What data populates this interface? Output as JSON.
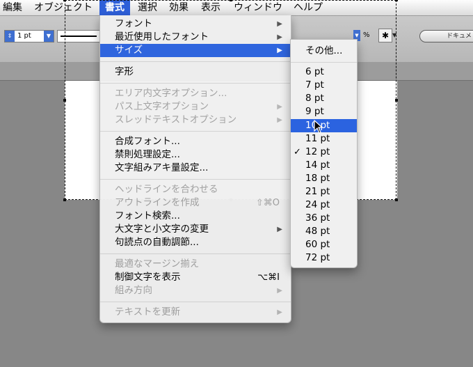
{
  "menubar": {
    "items": [
      {
        "label": "編集"
      },
      {
        "label": "オブジェクト"
      },
      {
        "label": "書式"
      },
      {
        "label": "選択"
      },
      {
        "label": "効果"
      },
      {
        "label": "表示"
      },
      {
        "label": "ウィンドウ"
      },
      {
        "label": "ヘルプ"
      }
    ]
  },
  "toolbar": {
    "stroke_value": "1 pt",
    "percent_symbol": "%",
    "doc_button": "ドキュメ"
  },
  "format_menu": {
    "items": [
      {
        "label": "フォント",
        "submenu": true
      },
      {
        "label": "最近使用したフォント",
        "submenu": true
      },
      {
        "label": "サイズ",
        "submenu": true,
        "selected": true
      },
      {
        "label": "字形"
      },
      {
        "label": "エリア内文字オプション...",
        "disabled": true
      },
      {
        "label": "パス上文字オプション",
        "disabled": true,
        "submenu": true
      },
      {
        "label": "スレッドテキストオプション",
        "disabled": true,
        "submenu": true
      },
      {
        "label": "合成フォント..."
      },
      {
        "label": "禁則処理設定..."
      },
      {
        "label": "文字組みアキ量設定..."
      },
      {
        "label": "ヘッドラインを合わせる",
        "disabled": true
      },
      {
        "label": "アウトラインを作成",
        "disabled": true,
        "shortcut": "⇧⌘O"
      },
      {
        "label": "フォント検索..."
      },
      {
        "label": "大文字と小文字の変更",
        "submenu": true
      },
      {
        "label": "句読点の自動調節..."
      },
      {
        "label": "最適なマージン揃え",
        "disabled": true
      },
      {
        "label": "制御文字を表示",
        "shortcut": "⌥⌘I"
      },
      {
        "label": "組み方向",
        "disabled": true,
        "submenu": true
      },
      {
        "label": "テキストを更新",
        "disabled": true,
        "submenu": true
      }
    ]
  },
  "size_submenu": {
    "items": [
      {
        "label": "その他..."
      },
      {
        "label": "6 pt"
      },
      {
        "label": "7 pt"
      },
      {
        "label": "8 pt"
      },
      {
        "label": "9 pt"
      },
      {
        "label": "10 pt",
        "selected": true
      },
      {
        "label": "11 pt"
      },
      {
        "label": "12 pt",
        "checked": true
      },
      {
        "label": "14 pt"
      },
      {
        "label": "18 pt"
      },
      {
        "label": "21 pt"
      },
      {
        "label": "24 pt"
      },
      {
        "label": "36 pt"
      },
      {
        "label": "48 pt"
      },
      {
        "label": "60 pt"
      },
      {
        "label": "72 pt"
      }
    ],
    "check_glyph": "✓"
  },
  "icons": {
    "submenu_arrow": "▶",
    "stepper": "⇕",
    "dropdown": "▼",
    "tool": "✱",
    "cursor": "arrow-pointer"
  },
  "colors": {
    "highlight": "#2b63e0",
    "menubar_active": "#2e5fd8"
  }
}
